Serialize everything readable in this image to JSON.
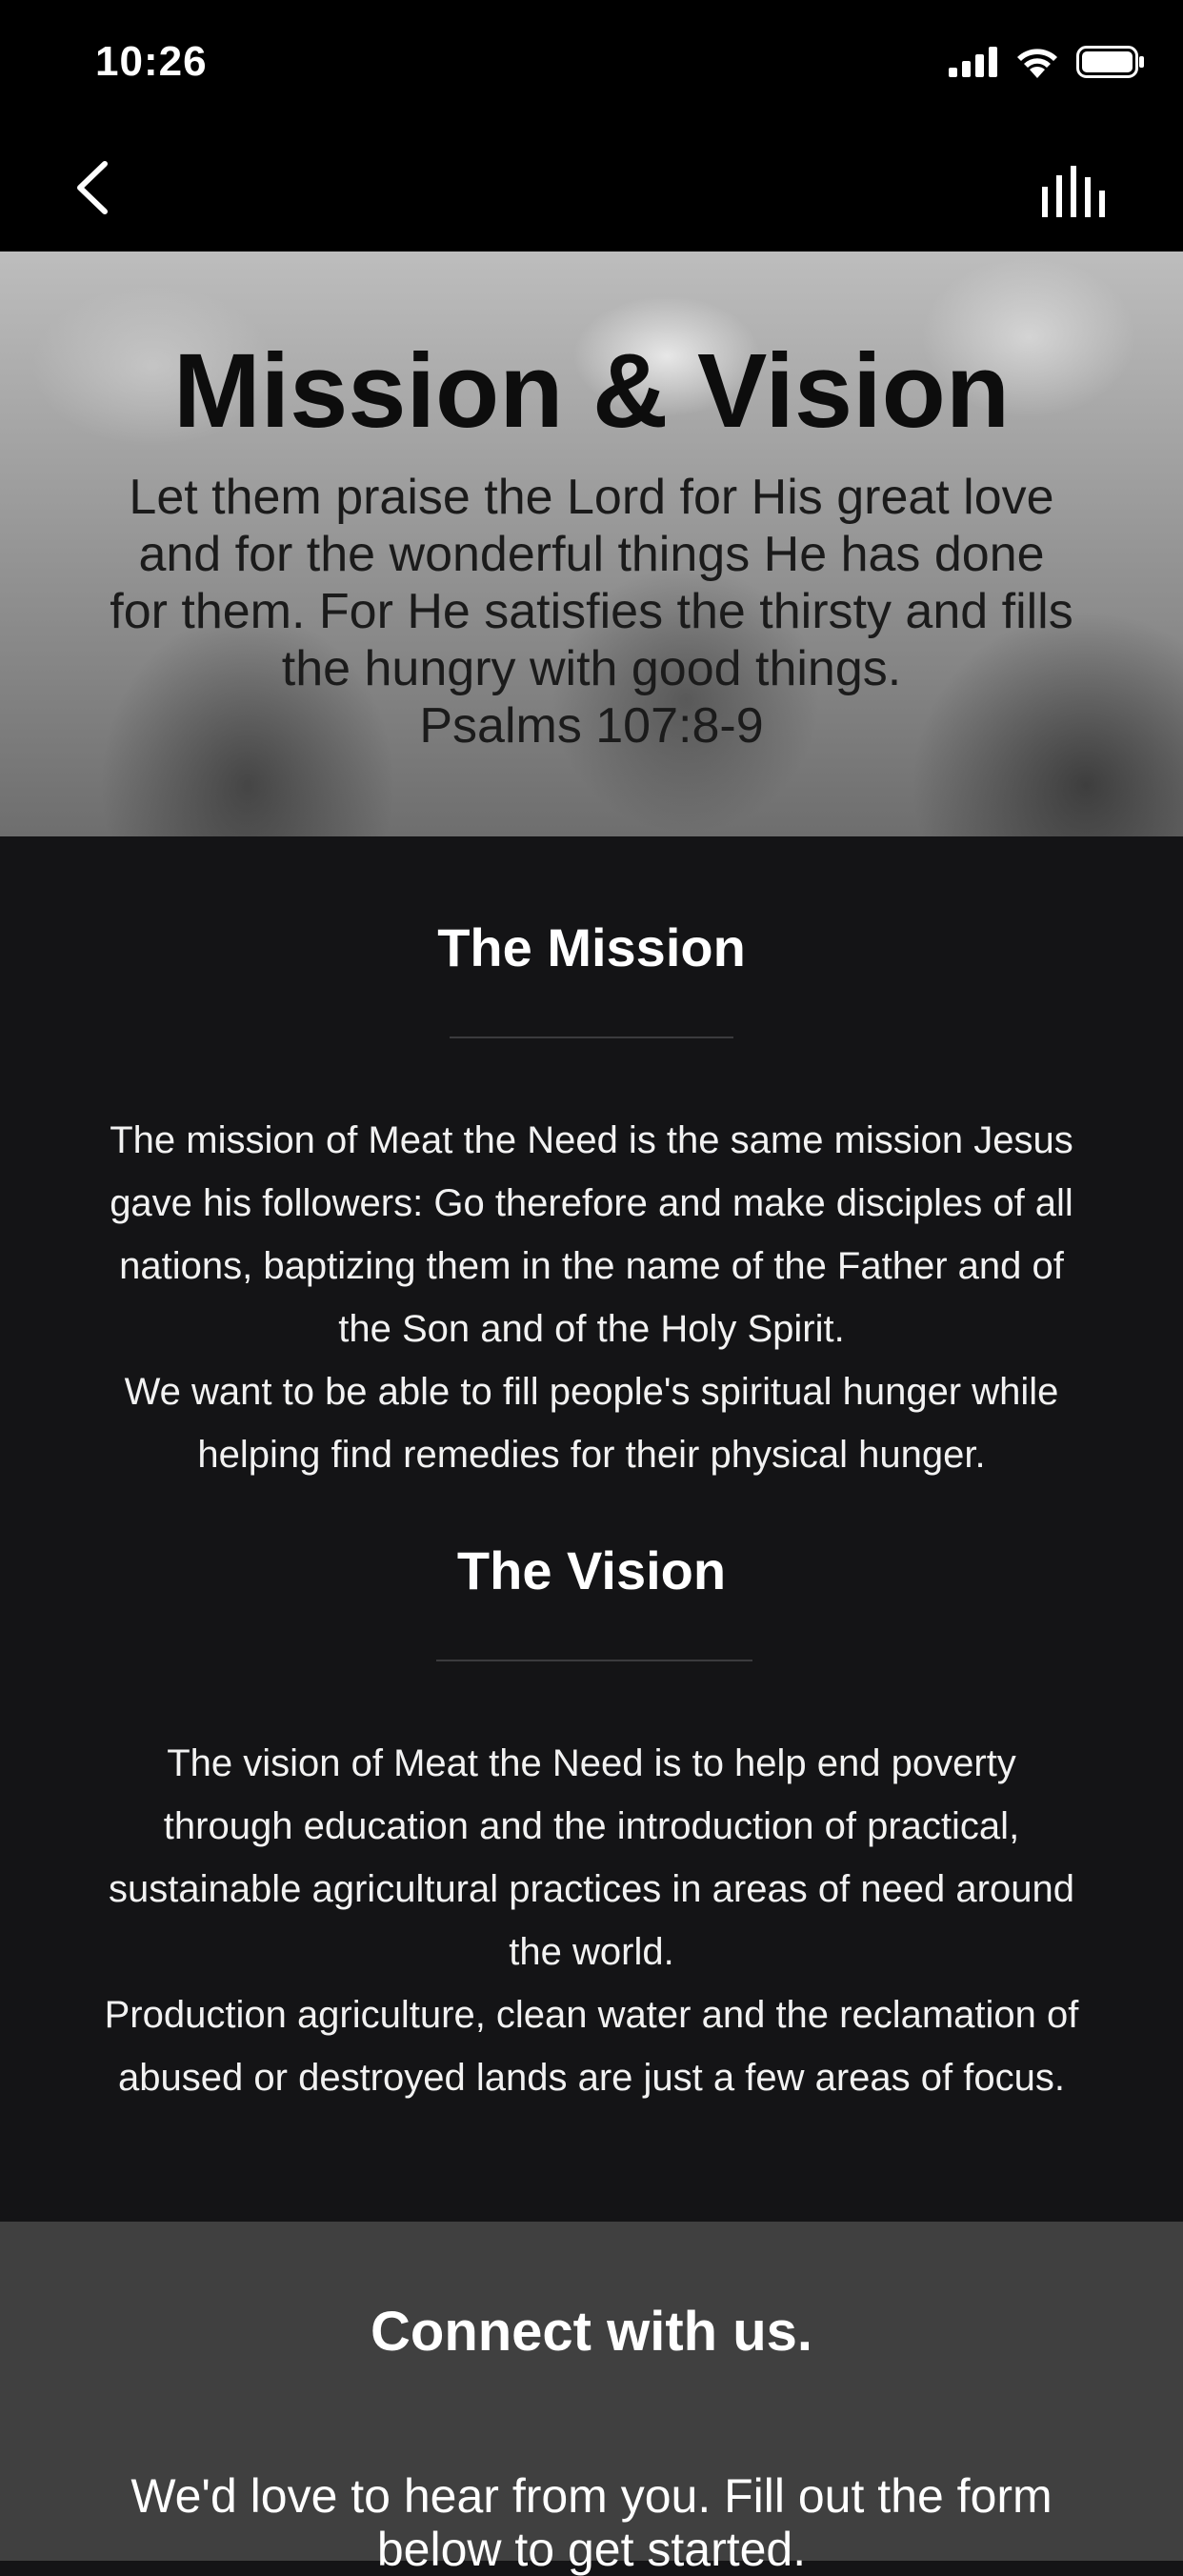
{
  "status_bar": {
    "time": "10:26",
    "icons": [
      "cellular-signal-icon",
      "wifi-icon",
      "battery-icon"
    ]
  },
  "nav": {
    "back_icon": "chevron-left-icon",
    "audio_icon": "audio-bars-icon"
  },
  "hero": {
    "title": "Mission & Vision",
    "quote_lines": [
      "Let them praise the Lord for His great love",
      "and for the wonderful things He has done",
      "for them. For He satisfies the thirsty and fills",
      "the hungry with good things."
    ],
    "reference": "Psalms 107:8-9"
  },
  "mission": {
    "title": "The Mission",
    "lines": [
      "The mission of Meat the Need is the same mission Jesus",
      "gave his followers: Go therefore and make disciples of all",
      "nations, baptizing them in the name of the Father and of",
      "the Son and of the Holy Spirit.",
      "We want to be able to fill people's spiritual hunger while",
      "helping find remedies for their physical hunger."
    ]
  },
  "vision": {
    "title": "The Vision",
    "lines": [
      "The vision of Meat the Need is to help end poverty",
      "through education and the introduction of practical,",
      "sustainable agricultural practices in areas of need around",
      "the world.",
      "Production agriculture, clean water and the reclamation of",
      "abused or destroyed lands are just a few areas of focus."
    ]
  },
  "connect": {
    "title": "Connect with us.",
    "lines": [
      "We'd love to hear from you. Fill out the form",
      "below to get started."
    ]
  },
  "colors": {
    "background": "#141416",
    "bars": "#000000",
    "connect_background": "#404040",
    "divider": "#3b3b3e"
  }
}
